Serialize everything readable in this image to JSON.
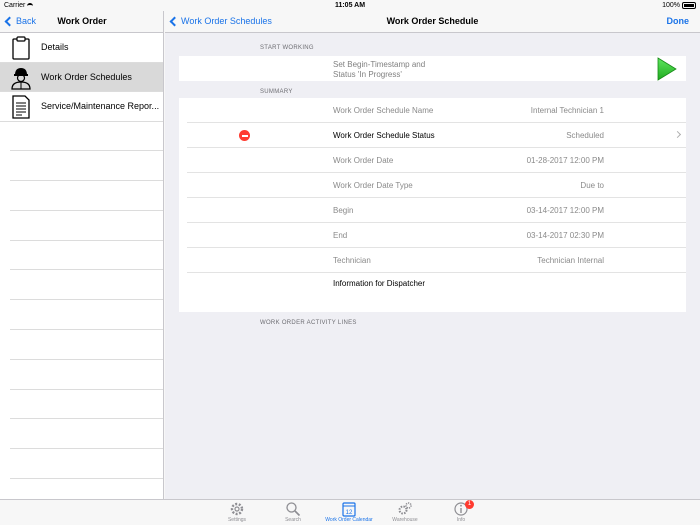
{
  "status_bar": {
    "carrier": "Carrier",
    "time": "11:05 AM",
    "battery": "100%"
  },
  "left": {
    "back_label": "Back",
    "title": "Work Order",
    "items": [
      {
        "label": "Details",
        "icon": "clipboard-icon",
        "selected": false
      },
      {
        "label": "Work Order Schedules",
        "icon": "technician-icon",
        "selected": true
      },
      {
        "label": "Service/Maintenance Repor...",
        "icon": "document-icon",
        "selected": false
      }
    ]
  },
  "right": {
    "back_label": "Work Order Schedules",
    "title": "Work Order Schedule",
    "done_label": "Done",
    "start_section": "START WORKING",
    "start_text_line1": "Set Begin-Timestamp and",
    "start_text_line2": "Status 'In Progress'",
    "summary_section": "SUMMARY",
    "rows": [
      {
        "label": "Work Order Schedule Name",
        "value": "Internal Technician 1"
      },
      {
        "label": "Work Order Schedule Status",
        "value": "Scheduled"
      },
      {
        "label": "Work Order Date",
        "value": "01-28-2017 12:00 PM"
      },
      {
        "label": "Work Order Date Type",
        "value": "Due to"
      },
      {
        "label": "Begin",
        "value": "03-14-2017 12:00 PM"
      },
      {
        "label": "End",
        "value": "03-14-2017 02:30 PM"
      },
      {
        "label": "Technician",
        "value": "Technician Internal"
      },
      {
        "label": "Information for Dispatcher",
        "value": ""
      }
    ],
    "activity_section": "WORK ORDER ACTIVITY LINES"
  },
  "tabs": [
    {
      "label": "Settings",
      "icon": "gear-icon"
    },
    {
      "label": "Search",
      "icon": "search-icon"
    },
    {
      "label": "Work Order Calendar",
      "icon": "calendar-icon",
      "calendar_day": "12"
    },
    {
      "label": "Warehouse",
      "icon": "warehouse-gears-icon"
    },
    {
      "label": "Info",
      "icon": "info-icon",
      "badge": "1"
    }
  ],
  "colors": {
    "accent": "#1a73e8",
    "play": "#2ecc2e",
    "delete": "#ff3b30"
  }
}
